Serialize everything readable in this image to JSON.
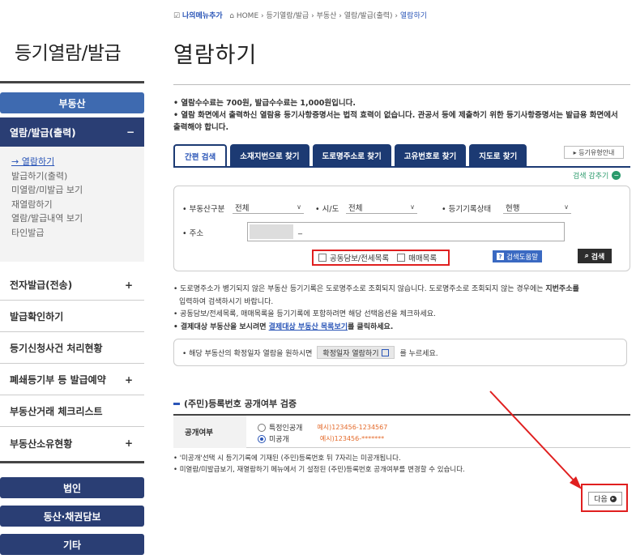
{
  "breadcrumb": {
    "my_menu": "나의메뉴추가",
    "home": "HOME",
    "sep": "›",
    "path1": "등기열람/발급",
    "path2": "부동산",
    "path3": "열람/발급(출력)",
    "current": "열람하기"
  },
  "sidebar": {
    "title": "등기열람/발급",
    "category": "부동산",
    "open_menu": "열람/발급(출력)",
    "open_toggle": "−",
    "sub_items": [
      "→ 열람하기",
      "발급하기(출력)",
      "미열람/미발급 보기",
      "재열람하기",
      "열람/발급내역 보기",
      "타인발급"
    ],
    "menus": [
      {
        "label": "전자발급(전송)",
        "toggle": "+"
      },
      {
        "label": "발급확인하기",
        "toggle": ""
      },
      {
        "label": "등기신청사건 처리현황",
        "toggle": ""
      },
      {
        "label": "폐쇄등기부 등 발급예약",
        "toggle": "+"
      },
      {
        "label": "부동산거래 체크리스트",
        "toggle": ""
      },
      {
        "label": "부동산소유현황",
        "toggle": "+"
      }
    ],
    "buttons": [
      "법인",
      "동산·채권담보",
      "기타"
    ]
  },
  "page": {
    "title": "열람하기",
    "notice": [
      "• 열람수수료는 700원, 발급수수료는 1,000원입니다.",
      "• 열람 화면에서 출력하신 열람용 등기사항증명서는 법적 효력이 없습니다. 관공서 등에 제출하기 위한 등기사항증명서는 발급용 화면에서 출력해야 합니다."
    ]
  },
  "tabs": [
    "간편 검색",
    "소재지번으로 찾기",
    "도로명주소로 찾기",
    "고유번호로 찾기",
    "지도로 찾기"
  ],
  "help_button": "▸ 등기유형안내",
  "collapse_label": "검색 감추기",
  "search": {
    "property_type_label": "• 부동산구분",
    "property_type_value": "전체",
    "sido_label": "• 시/도",
    "sido_value": "전체",
    "status_label": "• 등기기록상태",
    "status_value": "현행",
    "address_label": "• 주소",
    "address_value": "_",
    "check1": "공동담보/전세목록",
    "check2": "매매목록",
    "help_label": "검색도움말",
    "search_label": "검색"
  },
  "notes": {
    "line1_a": "• 도로명주소가 병기되지 않은 부동산 등기기록은 도로명주소로 조회되지 않습니다. 도로명주소로 조회되지 않는 경우에는 ",
    "line1_b": "지번주소를",
    "line1_c": "입력하여 검색하시기 바랍니다.",
    "line2": "• 공동담보/전세목록, 매매목록을 등기기록에 포함하려면 해당 선택옵션을 체크하세요.",
    "line3_a": "• 결제대상 부동산을 보시려면 ",
    "line3_link": "결제대상 부동산 목록보기",
    "line3_b": "를 클릭하세요."
  },
  "info_box": {
    "text_a": "• 해당 부동산의 확정일자 열람을 원하시면",
    "button": "확정일자 열람하기",
    "text_b": "를 누르세요."
  },
  "section": {
    "title": "(주민)등록번호 공개여부 검증",
    "th": "공개여부",
    "opt1": "특정인공개",
    "opt1_example": "예시)123456-1234567",
    "opt2": "미공개",
    "opt2_example": "예시)123456-*******",
    "note1": "• '미공개'선택 시 등기기록에 기재된 (주민)등록번호 뒤 7자리는 미공개됩니다.",
    "note2": "• 미열람/미발급보기, 재열람하기 메뉴에서 기 설정된 (주민)등록번호 공개여부를 변경할 수 있습니다."
  },
  "next_button": "다음",
  "colors": {
    "navy": "#1c3a73",
    "blue": "#3e6ab0",
    "red": "#e01f1f",
    "link": "#2a55b7",
    "green": "#2a9a6b"
  }
}
